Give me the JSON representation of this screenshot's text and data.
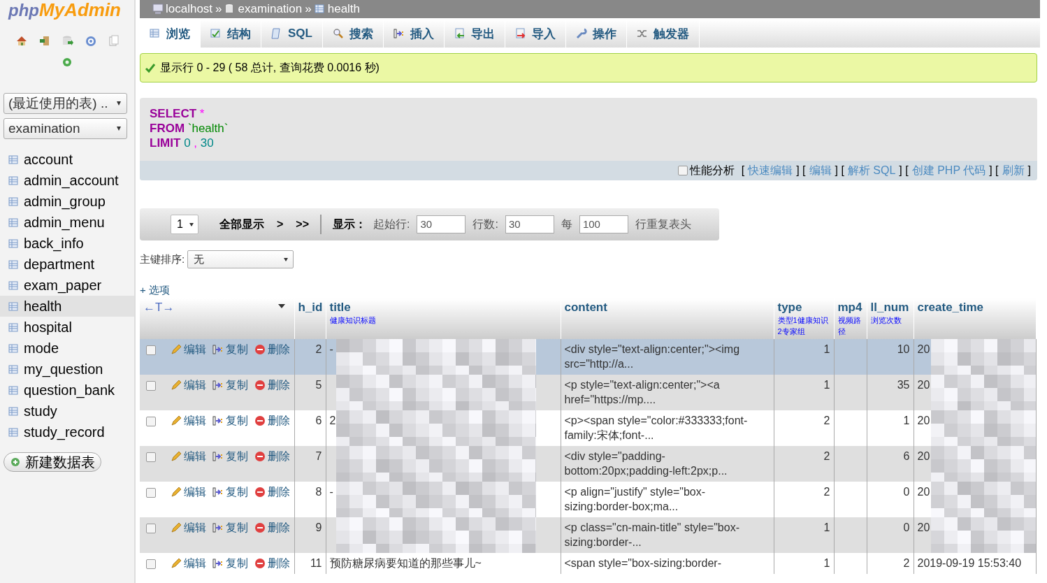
{
  "sidebar": {
    "logo_php": "php",
    "logo_name": "MyAdmin",
    "recent_select": "(最近使用的表) ..",
    "db_select": "examination",
    "tables": [
      {
        "name": "account",
        "selected": false
      },
      {
        "name": "admin_account",
        "selected": false
      },
      {
        "name": "admin_group",
        "selected": false
      },
      {
        "name": "admin_menu",
        "selected": false
      },
      {
        "name": "back_info",
        "selected": false
      },
      {
        "name": "department",
        "selected": false
      },
      {
        "name": "exam_paper",
        "selected": false
      },
      {
        "name": "health",
        "selected": true
      },
      {
        "name": "hospital",
        "selected": false
      },
      {
        "name": "mode",
        "selected": false
      },
      {
        "name": "my_question",
        "selected": false
      },
      {
        "name": "question_bank",
        "selected": false
      },
      {
        "name": "study",
        "selected": false
      },
      {
        "name": "study_record",
        "selected": false
      }
    ],
    "new_table_button": "新建数据表"
  },
  "breadcrumb": [
    {
      "kind": "server",
      "text": "localhost"
    },
    {
      "kind": "sep",
      "text": "»"
    },
    {
      "kind": "database",
      "text": "examination"
    },
    {
      "kind": "sep",
      "text": "»"
    },
    {
      "kind": "table",
      "text": "health"
    }
  ],
  "tabs": [
    {
      "kind": "browse",
      "label": "浏览",
      "selected": true
    },
    {
      "kind": "structure",
      "label": "结构",
      "selected": false
    },
    {
      "kind": "sql",
      "label": "SQL",
      "selected": false
    },
    {
      "kind": "search",
      "label": "搜索",
      "selected": false
    },
    {
      "kind": "insert",
      "label": "插入",
      "selected": false
    },
    {
      "kind": "export",
      "label": "导出",
      "selected": false
    },
    {
      "kind": "import",
      "label": "导入",
      "selected": false
    },
    {
      "kind": "operations",
      "label": "操作",
      "selected": false
    },
    {
      "kind": "triggers",
      "label": "触发器",
      "selected": false
    }
  ],
  "success_message": "显示行 0 - 29 ( 58 总计, 查询花费 0.0016 秒)",
  "query": {
    "lines": [
      [
        {
          "kind": "keyword",
          "text": "SELECT"
        },
        {
          "kind": "operator",
          "text": "*"
        }
      ],
      [
        {
          "kind": "keyword",
          "text": "FROM"
        },
        {
          "kind": "string",
          "text": "`health`"
        }
      ],
      [
        {
          "kind": "keyword",
          "text": "LIMIT"
        },
        {
          "kind": "number",
          "text": "0"
        },
        {
          "kind": "operator",
          "text": ","
        },
        {
          "kind": "number",
          "text": "30"
        }
      ]
    ],
    "profiling": {
      "label": "性能分析",
      "checked": false
    },
    "links": [
      {
        "kind": "text",
        "text": "["
      },
      {
        "kind": "link",
        "text": "快速编辑"
      },
      {
        "kind": "text",
        "text": "] ["
      },
      {
        "kind": "link",
        "text": "编辑"
      },
      {
        "kind": "text",
        "text": "] ["
      },
      {
        "kind": "link",
        "text": "解析 SQL"
      },
      {
        "kind": "text",
        "text": "] ["
      },
      {
        "kind": "link",
        "text": "创建 PHP 代码"
      },
      {
        "kind": "text",
        "text": "] ["
      },
      {
        "kind": "link",
        "text": "刷新"
      },
      {
        "kind": "text",
        "text": "]"
      }
    ]
  },
  "navigation": {
    "page": "1",
    "show_all": "全部显示",
    "next": ">",
    "last": ">>",
    "show_label": "显示：",
    "start_label": "起始行:",
    "start_value": "30",
    "rows_label": "行数:",
    "rows_value": "30",
    "every_label": "每",
    "every_value": "100",
    "repeat_label": "行重复表头"
  },
  "sort": {
    "label": "主键排序:",
    "value": "无"
  },
  "options_link": "+ 选项",
  "table": {
    "arrows": "←T→",
    "columns": [
      {
        "name": "h_id"
      },
      {
        "name": "title",
        "comment": "健康知识标题"
      },
      {
        "name": "content"
      },
      {
        "name": "type",
        "comment": "类型1健康知识2专家组"
      },
      {
        "name": "mp4",
        "comment": "视频路径"
      },
      {
        "name": "ll_num",
        "comment": "浏览次数"
      },
      {
        "name": "create_time"
      }
    ],
    "rows": [
      {
        "actions": {
          "edit": "编辑",
          "copy": "复制",
          "delete": "删除"
        },
        "checked": false,
        "selected": true,
        "redacted": true,
        "h_id": "2",
        "title": "-",
        "content": "<div style=\"text-align:center;\"><img src=\"http://a...",
        "type": "1",
        "ll_num": "10",
        "create_time": "20"
      },
      {
        "actions": {
          "edit": "编辑",
          "copy": "复制",
          "delete": "删除"
        },
        "checked": false,
        "selected": false,
        "redacted": true,
        "h_id": "5",
        "content": "<p style=\"text-align:center;\"><a href=\"https://mp....",
        "type": "1",
        "ll_num": "35",
        "create_time": "20"
      },
      {
        "actions": {
          "edit": "编辑",
          "copy": "复制",
          "delete": "删除"
        },
        "checked": false,
        "selected": false,
        "redacted": true,
        "h_id": "6",
        "title": "2",
        "content": "<p><span style=\"color:#333333;font-family:宋体;font-...",
        "type": "2",
        "ll_num": "1",
        "create_time": "20"
      },
      {
        "actions": {
          "edit": "编辑",
          "copy": "复制",
          "delete": "删除"
        },
        "checked": false,
        "selected": false,
        "redacted": true,
        "h_id": "7",
        "content": "<div style=\"padding-bottom:20px;padding-left:2px;p...",
        "type": "2",
        "ll_num": "6",
        "create_time": "20"
      },
      {
        "actions": {
          "edit": "编辑",
          "copy": "复制",
          "delete": "删除"
        },
        "checked": false,
        "selected": false,
        "redacted": true,
        "h_id": "8",
        "title": "-",
        "content": "<p align=\"justify\" style=\"box-sizing:border-box;ma...",
        "type": "2",
        "ll_num": "0",
        "create_time": "20"
      },
      {
        "actions": {
          "edit": "编辑",
          "copy": "复制",
          "delete": "删除"
        },
        "checked": false,
        "selected": false,
        "redacted": true,
        "h_id": "9",
        "content": "<p class=\"cn-main-title\" style=\"box-sizing:border-...",
        "type": "1",
        "ll_num": "0",
        "create_time": "20"
      },
      {
        "actions": {
          "edit": "编辑",
          "copy": "复制",
          "delete": "删除"
        },
        "checked": false,
        "selected": false,
        "redacted": false,
        "h_id": "11",
        "title": "预防糖尿病要知道的那些事儿~",
        "content": "<span style=\"box-sizing:border-",
        "type": "1",
        "ll_num": "2",
        "create_time": "2019-09-19 15:53:40"
      }
    ]
  }
}
